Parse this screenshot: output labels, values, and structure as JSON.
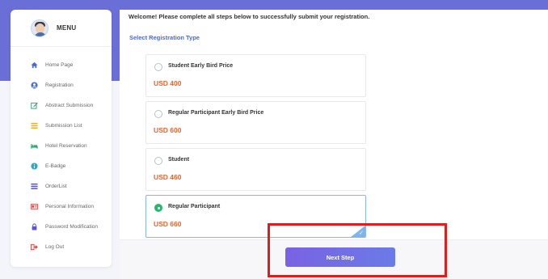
{
  "sidebar": {
    "menu_title": "MENU",
    "items": [
      {
        "label": "Home Page",
        "icon": "home-icon",
        "color": "#4a6ad8"
      },
      {
        "label": "Registration",
        "icon": "user-circle-icon",
        "color": "#4a6ad8"
      },
      {
        "label": "Abstract Submission",
        "icon": "edit-icon",
        "color": "#1ea36b"
      },
      {
        "label": "Submission List",
        "icon": "list-icon",
        "color": "#f2b01e"
      },
      {
        "label": "Hotel Reservation",
        "icon": "bed-icon",
        "color": "#1ea36b"
      },
      {
        "label": "E-Badge",
        "icon": "info-icon",
        "color": "#2aa6c9"
      },
      {
        "label": "OrderList",
        "icon": "order-list-icon",
        "color": "#5a54d6"
      },
      {
        "label": "Personal Information",
        "icon": "id-card-icon",
        "color": "#e23b3b"
      },
      {
        "label": "Password Modification",
        "icon": "lock-icon",
        "color": "#5a54d6"
      },
      {
        "label": "Log Out",
        "icon": "logout-icon",
        "color": "#e23b3b"
      }
    ]
  },
  "header": {
    "welcome": "Welcome! Please complete all steps below to successfully submit your registration."
  },
  "registration": {
    "section_title": "Select Registration Type",
    "options": [
      {
        "label": "Student Early Bird Price",
        "price": "USD 400",
        "selected": false
      },
      {
        "label": "Regular Participant Early Bird Price",
        "price": "USD 600",
        "selected": false
      },
      {
        "label": "Student",
        "price": "USD 460",
        "selected": false
      },
      {
        "label": "Regular Participant",
        "price": "USD 660",
        "selected": true
      }
    ]
  },
  "footer": {
    "next_label": "Next Step"
  },
  "colors": {
    "accent": "#4a6ad8",
    "price": "#e8642a",
    "selected_radio": "#25b86a",
    "button": "#7a62e3",
    "highlight": "#e31b1b"
  }
}
